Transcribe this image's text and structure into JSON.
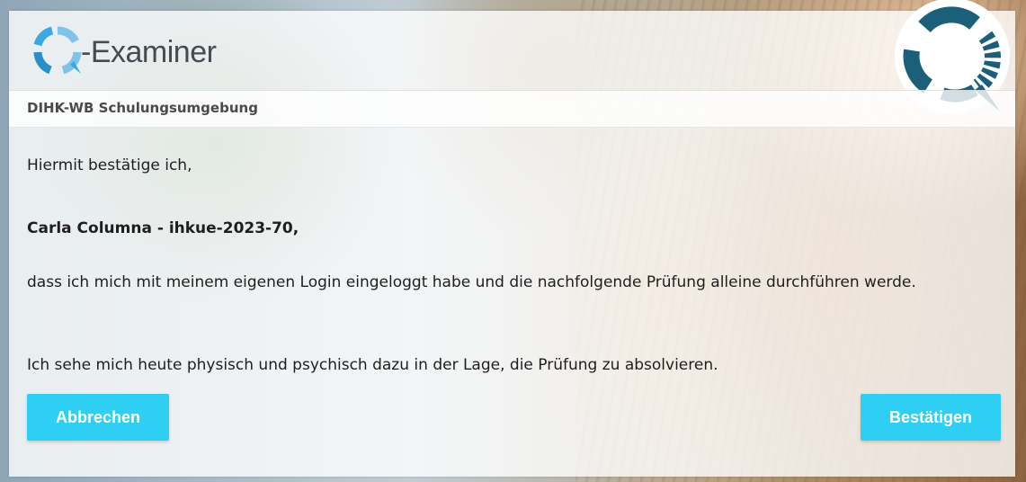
{
  "brand": {
    "name": "-Examiner",
    "logo_icon": "q-examiner-logo-icon",
    "corner_icon": "q-examiner-corner-logo-icon"
  },
  "environment": {
    "label": "DIHK-WB Schulungsumgebung"
  },
  "confirmation": {
    "intro": "Hiermit bestätige ich,",
    "candidate": "Carla Columna - ihkue-2023-70,",
    "statement": "dass ich mich mit meinem eigenen Login eingeloggt habe und die nachfolgende Prüfung alleine durchführen werde.",
    "health": "Ich sehe mich heute physisch und psychisch dazu in der Lage, die Prüfung zu absolvieren."
  },
  "actions": {
    "cancel_label": "Abbrechen",
    "confirm_label": "Bestätigen"
  },
  "colors": {
    "button": "#2ecff2",
    "logo_light": "#39a9e0",
    "logo_dark": "#1b5f7a"
  }
}
